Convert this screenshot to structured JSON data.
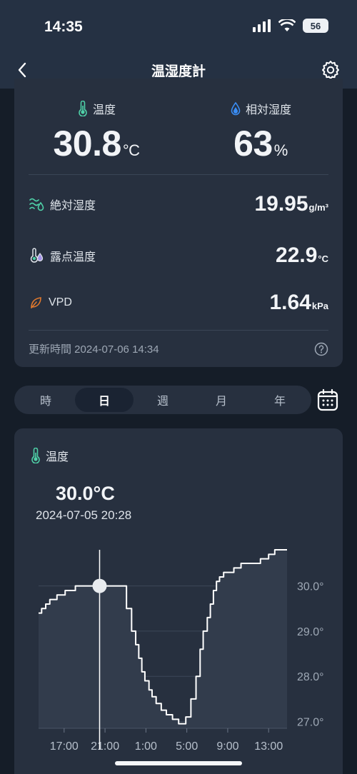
{
  "status": {
    "time": "14:35",
    "battery": "56"
  },
  "nav": {
    "title": "温湿度計"
  },
  "temperature": {
    "label": "温度",
    "value": "30.8",
    "unit": "°C"
  },
  "humidity": {
    "label": "相対湿度",
    "value": "63",
    "unit": "%"
  },
  "rows": [
    {
      "label": "絶対湿度",
      "value": "19.95",
      "unit": "g/m³"
    },
    {
      "label": "露点温度",
      "value": "22.9",
      "unit": "°C"
    },
    {
      "label": "VPD",
      "value": "1.64",
      "unit": "kPa"
    }
  ],
  "updated": "更新時間 2024-07-06 14:34",
  "tabs": [
    {
      "label": "時",
      "active": false
    },
    {
      "label": "日",
      "active": true
    },
    {
      "label": "週",
      "active": false
    },
    {
      "label": "月",
      "active": false
    },
    {
      "label": "年",
      "active": false
    }
  ],
  "chart": {
    "label": "温度",
    "selected_value": "30.0°C",
    "selected_time": "2024-07-05 20:28"
  },
  "colors": {
    "accent_green": "#4fd1a8",
    "accent_blue": "#3a8df5",
    "accent_orange": "#e0792e"
  },
  "chart_data": {
    "type": "line",
    "title": "",
    "ylabel": "",
    "y_ticks": [
      "30.0°",
      "29.0°",
      "28.0°",
      "27.0°"
    ],
    "x_ticks": [
      "17:00",
      "21:00",
      "1:00",
      "5:00",
      "9:00",
      "13:00"
    ],
    "ylim": [
      26.85,
      30.8
    ],
    "x_hours_range": [
      14.5,
      38.8
    ],
    "series": [
      {
        "x": [
          14.5,
          14.8,
          15.2,
          15.6,
          16.3,
          17.1,
          18.1,
          18.9,
          19.6,
          20.3,
          20.5,
          21.1,
          22.2,
          23.1,
          23.6,
          24.0,
          24.3,
          24.6,
          24.9,
          25.3,
          25.6,
          26.0,
          26.5,
          27.0,
          27.6,
          28.2,
          28.9,
          29.4,
          29.9,
          30.3,
          30.6,
          31.0,
          31.3,
          31.6,
          31.9,
          32.2,
          32.6,
          33.1,
          33.6,
          34.3,
          35.3,
          36.2,
          37.0,
          37.6,
          38.1,
          38.8
        ],
        "y": [
          29.4,
          29.5,
          29.6,
          29.7,
          29.8,
          29.9,
          30.0,
          30.0,
          30.0,
          30.0,
          30.0,
          30.0,
          30.0,
          29.5,
          29.0,
          28.7,
          28.4,
          28.1,
          27.9,
          27.7,
          27.55,
          27.4,
          27.25,
          27.15,
          27.05,
          26.95,
          27.1,
          27.5,
          28.0,
          28.6,
          29.0,
          29.3,
          29.6,
          29.9,
          30.1,
          30.2,
          30.3,
          30.3,
          30.4,
          30.5,
          30.5,
          30.6,
          30.7,
          30.8,
          30.8,
          30.8
        ]
      }
    ],
    "selected_x": 20.47,
    "grid": true
  }
}
